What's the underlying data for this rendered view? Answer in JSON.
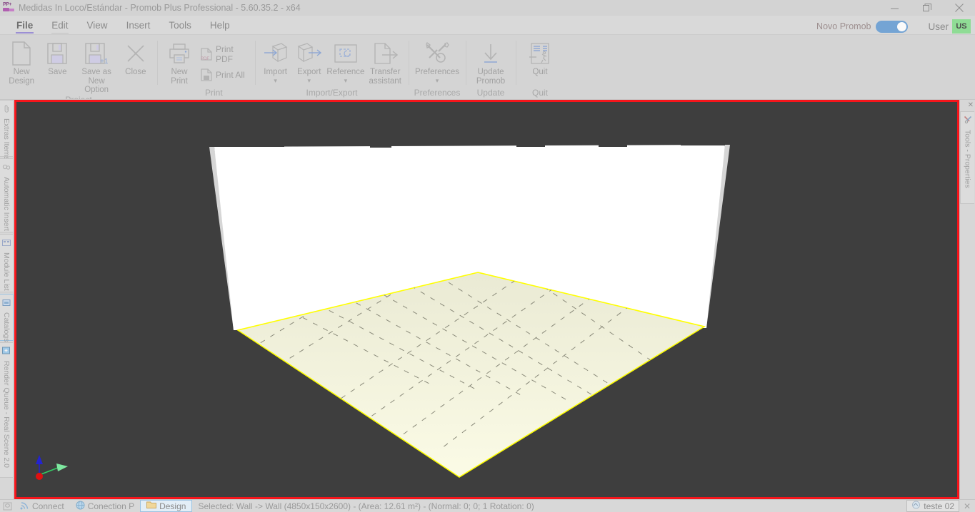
{
  "window": {
    "title": "Medidas In Loco/Estándar - Promob Plus Professional - 5.60.35.2 - x64",
    "logo_text": "PP+",
    "minimize": "—",
    "restore": "❐",
    "close": "✕"
  },
  "menu": {
    "items": [
      {
        "label": "File",
        "state": "active"
      },
      {
        "label": "Edit",
        "state": "edit"
      },
      {
        "label": "View",
        "state": "normal"
      },
      {
        "label": "Insert",
        "state": "normal"
      },
      {
        "label": "Tools",
        "state": "normal"
      },
      {
        "label": "Help",
        "state": "normal"
      }
    ]
  },
  "account": {
    "novo_promob_label": "Novo Promob",
    "novo_promob_on": true,
    "user_label": "User",
    "user_flag": "US"
  },
  "ribbon": {
    "groups": [
      {
        "title": "Project",
        "buttons": [
          {
            "label": "New\nDesign",
            "icon": "new-document-icon",
            "caret": false
          },
          {
            "label": "Save",
            "icon": "floppy-disk-icon",
            "caret": false
          },
          {
            "label": "Save as New\nOption",
            "icon": "floppy-disk-plus-icon",
            "caret": false
          },
          {
            "label": "Close",
            "icon": "close-x-icon",
            "caret": false
          }
        ]
      },
      {
        "title": "Print",
        "buttons": [
          {
            "label": "New\nPrint",
            "icon": "printer-icon",
            "caret": false
          }
        ],
        "small_buttons": [
          {
            "label": "Print PDF",
            "icon": "pdf-file-icon"
          },
          {
            "label": "Print All",
            "icon": "print-all-icon"
          }
        ]
      },
      {
        "title": "Import/Export",
        "buttons": [
          {
            "label": "Import",
            "icon": "import-cube-icon",
            "caret": true
          },
          {
            "label": "Export",
            "icon": "export-cube-icon",
            "caret": true
          },
          {
            "label": "Reference",
            "icon": "reference-frame-icon",
            "caret": true
          },
          {
            "label": "Transfer\nassistant",
            "icon": "transfer-document-icon",
            "caret": false
          }
        ]
      },
      {
        "title": "Preferences",
        "buttons": [
          {
            "label": "Preferences",
            "icon": "tools-wrench-icon",
            "caret": true
          }
        ]
      },
      {
        "title": "Update",
        "buttons": [
          {
            "label": "Update\nPromob",
            "icon": "download-arrow-icon",
            "caret": false
          }
        ]
      },
      {
        "title": "Quit",
        "buttons": [
          {
            "label": "Quit",
            "icon": "exit-door-icon",
            "caret": false
          }
        ]
      }
    ]
  },
  "left_dock": {
    "tabs": [
      {
        "label": "Extras Items",
        "icon": "paperclip-icon",
        "selected": false
      },
      {
        "label": "Automatic Insert",
        "icon": "gears-icon",
        "selected": false
      },
      {
        "label": "Module List",
        "icon": "module-list-icon",
        "selected": false
      },
      {
        "label": "Catalogs",
        "icon": "catalogs-icon",
        "selected": true
      },
      {
        "label": "Render Queue - Real Scene 2.0",
        "icon": "render-queue-icon",
        "selected": false
      }
    ]
  },
  "right_dock": {
    "close_label": "✕",
    "tabs": [
      {
        "label": "Tools - Properties",
        "icon": "tools-properties-icon",
        "selected": false
      }
    ]
  },
  "viewport": {
    "border_color": "#f5151b",
    "background_color": "#3e3e3e",
    "wall_color": "#ffffff",
    "wall_edge_color": "#d6d6d6",
    "floor_color_top": "#eeeedb",
    "floor_color_bottom": "#fbfbe4",
    "floor_outline_color": "#ffff00",
    "grid_line_color": "#8a8a7a",
    "axis": {
      "x_color": "#32cd64",
      "y_color": "#2323d2",
      "z_color": "#e01010",
      "name": "axis-gizmo"
    }
  },
  "statusbar": {
    "connect_label": "Connect",
    "connect_icon": "wifi-icon",
    "conection_label": "Conection P",
    "conection_icon": "globe-icon",
    "design_label": "Design",
    "design_icon": "folder-icon",
    "status_text": "Selected: Wall -> Wall (4850x150x2600) - (Area: 12.61 m²) - (Normal: 0; 0; 1 Rotation: 0)",
    "tab_label": "teste 02",
    "tab_icon": "design-file-icon",
    "tab_close": "✕"
  }
}
